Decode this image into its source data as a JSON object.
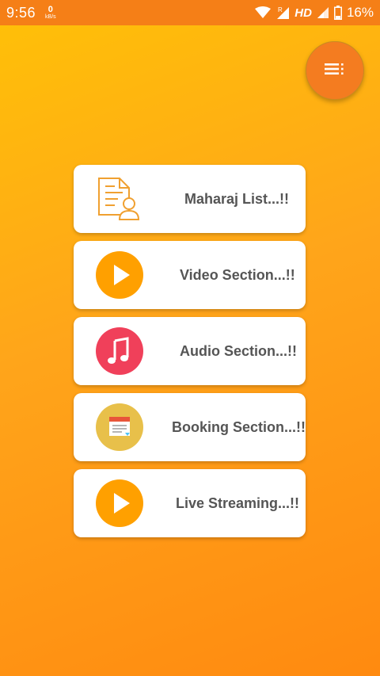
{
  "status_bar": {
    "time": "9:56",
    "net_speed_value": "0",
    "net_speed_unit": "kB/s",
    "network_type": "HD",
    "battery": "16%"
  },
  "fab": {
    "icon": "menu-list-icon"
  },
  "menu": {
    "items": [
      {
        "label": "Maharaj List...!!",
        "icon": "document-person-icon"
      },
      {
        "label": "Video Section...!!",
        "icon": "play-icon"
      },
      {
        "label": "Audio Section...!!",
        "icon": "music-note-icon"
      },
      {
        "label": "Booking Section...!!",
        "icon": "calendar-icon"
      },
      {
        "label": "Live Streaming...!!",
        "icon": "play-icon"
      }
    ]
  },
  "colors": {
    "status_bar": "#f57f17",
    "background_top": "#ffc107",
    "background_bottom": "#ff8a10",
    "fab": "#f47c20",
    "play_circle": "#ffa000",
    "audio_circle": "#f0405a",
    "booking_circle": "#e8c04a",
    "label_text": "#555555"
  }
}
